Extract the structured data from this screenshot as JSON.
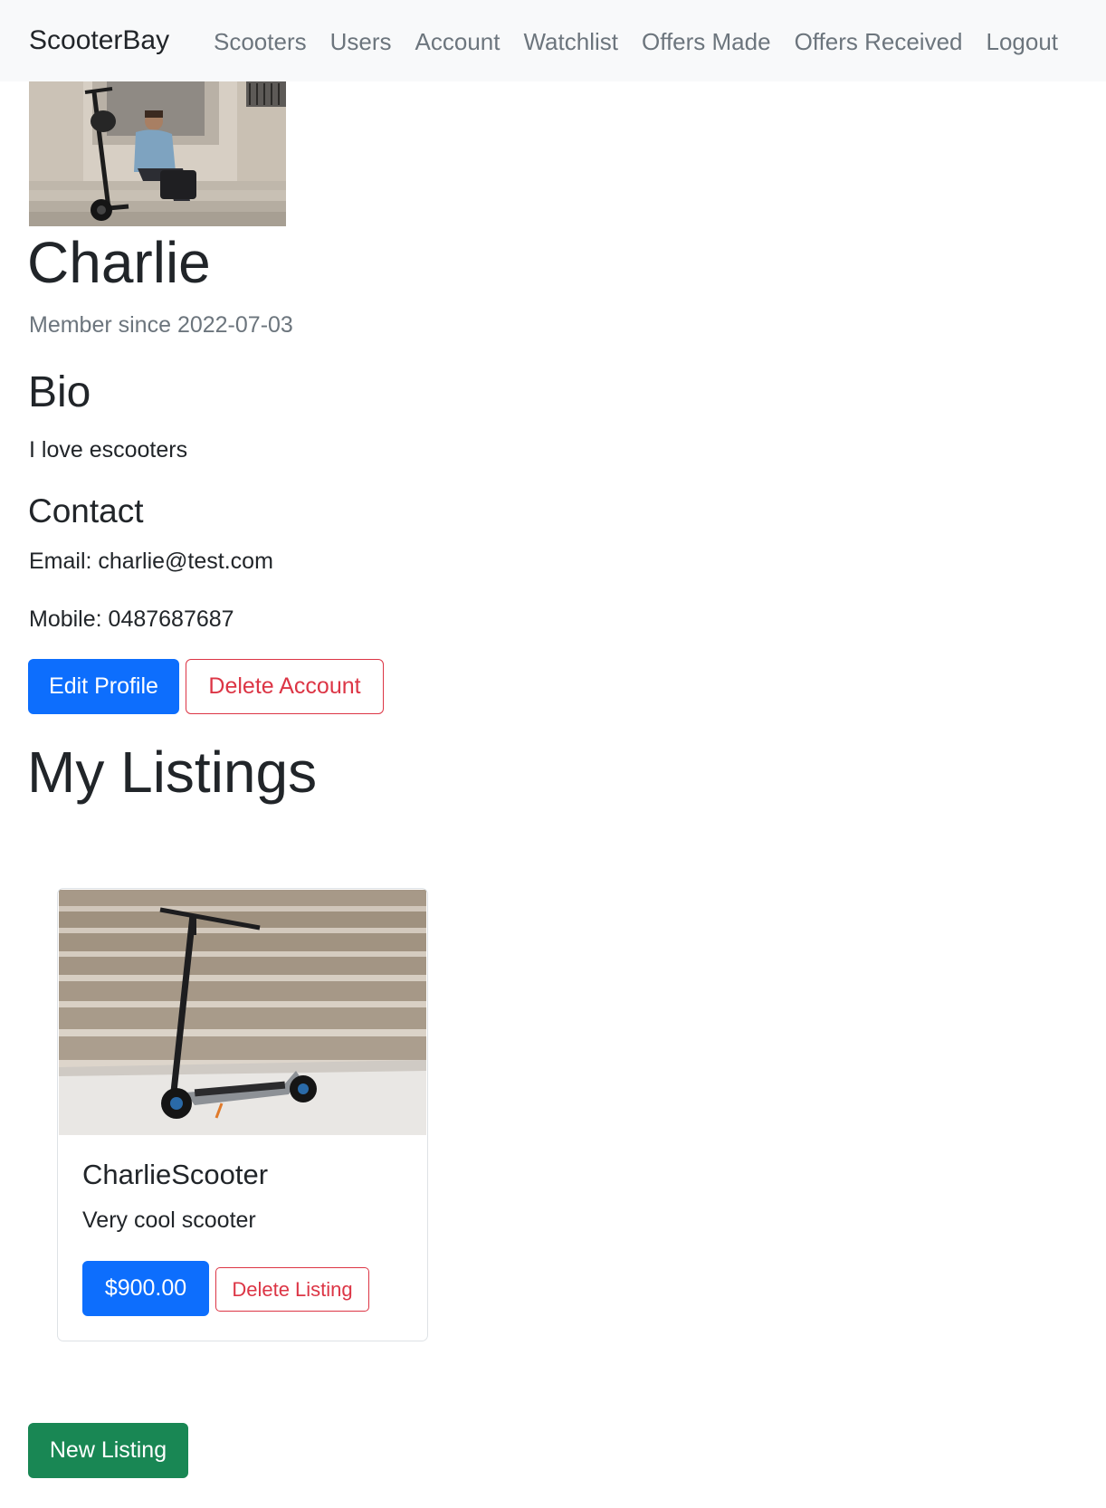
{
  "navbar": {
    "brand": "ScooterBay",
    "links": [
      {
        "label": "Scooters"
      },
      {
        "label": "Users"
      },
      {
        "label": "Account"
      },
      {
        "label": "Watchlist"
      },
      {
        "label": "Offers Made"
      },
      {
        "label": "Offers Received"
      },
      {
        "label": "Logout"
      }
    ]
  },
  "profile": {
    "name": "Charlie",
    "member_since": "Member since 2022-07-03",
    "bio_heading": "Bio",
    "bio": "I love escooters",
    "contact_heading": "Contact",
    "email": "Email: charlie@test.com",
    "mobile": "Mobile: 0487687687",
    "edit_button": "Edit Profile",
    "delete_button": "Delete Account"
  },
  "listings": {
    "heading": "My Listings",
    "items": [
      {
        "title": "CharlieScooter",
        "description": "Very cool scooter",
        "price": "$900.00",
        "delete_label": "Delete Listing"
      }
    ],
    "new_button": "New Listing"
  },
  "colors": {
    "primary": "#0d6efd",
    "danger": "#dc3545",
    "success": "#198754",
    "navbar_bg": "#f8f9fa",
    "muted": "#6c757d"
  }
}
